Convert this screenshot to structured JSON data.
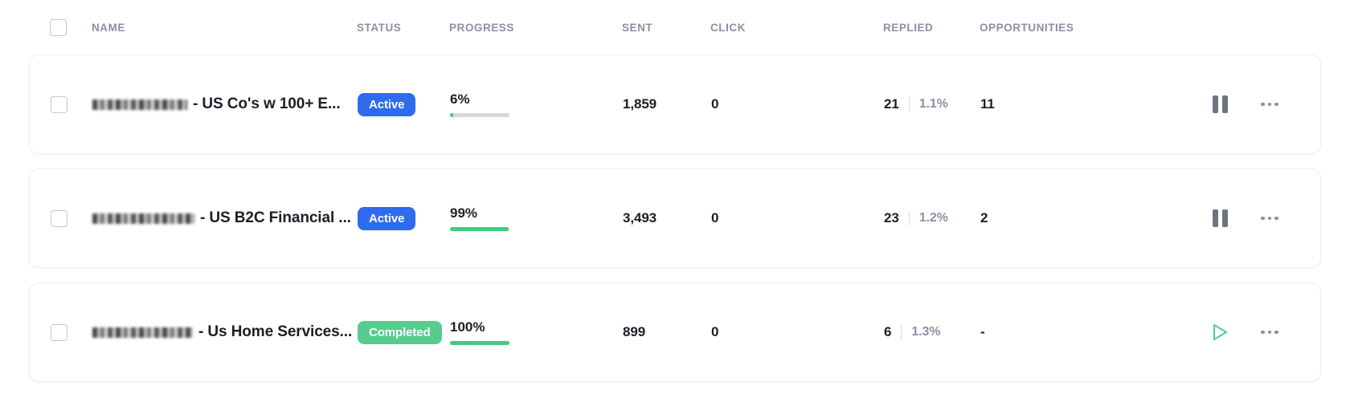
{
  "table": {
    "columns": {
      "select_all": "",
      "name": "NAME",
      "status": "STATUS",
      "progress": "PROGRESS",
      "sent": "SENT",
      "click": "CLICK",
      "replied": "REPLIED",
      "opportunities": "OPPORTUNITIES"
    },
    "rows": [
      {
        "name_suffix": "- US Co's w 100+ E...",
        "name_redacted": true,
        "status": "Active",
        "status_color": "#2f6bed",
        "progress_label": "6%",
        "progress_value": 6,
        "sent": "1,859",
        "click": "0",
        "replied": "21",
        "replied_rate": "1.1%",
        "opportunities": "11",
        "primary_action": "pause",
        "more_action": "more-options"
      },
      {
        "name_suffix": "- US B2C Financial ...",
        "name_redacted": true,
        "status": "Active",
        "status_color": "#2f6bed",
        "progress_label": "99%",
        "progress_value": 99,
        "sent": "3,493",
        "click": "0",
        "replied": "23",
        "replied_rate": "1.2%",
        "opportunities": "2",
        "primary_action": "pause",
        "more_action": "more-options"
      },
      {
        "name_suffix": "- Us Home Services...",
        "name_redacted": true,
        "status": "Completed",
        "status_color": "#57cc8f",
        "progress_label": "100%",
        "progress_value": 100,
        "sent": "899",
        "click": "0",
        "replied": "6",
        "replied_rate": "1.3%",
        "opportunities": "-",
        "primary_action": "play",
        "more_action": "more-options"
      }
    ]
  },
  "theme": {
    "progress_fill": "#3fcb7f",
    "progress_track": "#d6d8dd",
    "header_text": "#8b90a0",
    "body_text": "#1c1e26",
    "row_border": "#eceef2"
  }
}
